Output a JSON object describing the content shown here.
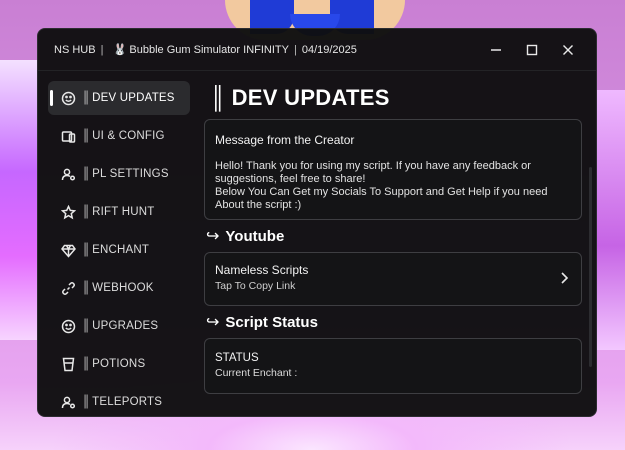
{
  "window": {
    "hub_name": "NS HUB",
    "game_title": "Bubble Gum Simulator INFINITY",
    "date": "04/19/2025",
    "rabbit_glyph": "🐰"
  },
  "sidebar": {
    "items": [
      {
        "label": "DEV UPDATES",
        "icon": "smile-icon"
      },
      {
        "label": "UI & CONFIG",
        "icon": "devices-icon"
      },
      {
        "label": "PL SETTINGS",
        "icon": "user-settings-icon"
      },
      {
        "label": "RIFT HUNT",
        "icon": "star-icon"
      },
      {
        "label": "ENCHANT",
        "icon": "gem-icon"
      },
      {
        "label": "WEBHOOK",
        "icon": "link-icon"
      },
      {
        "label": "UPGRADES",
        "icon": "smile-icon"
      },
      {
        "label": "POTIONS",
        "icon": "cup-icon"
      },
      {
        "label": "TELEPORTS",
        "icon": "user-settings-icon"
      }
    ],
    "pipes": "║"
  },
  "content": {
    "title": "DEV UPDATES",
    "message_card": {
      "heading": "Message from the Creator",
      "line1": "Hello! Thank you for using my script. If you have any feedback or suggestions, feel free to share!",
      "line2": "Below You Can Get my Socials To Support and Get Help if you need About the script :)"
    },
    "youtube_section": "Youtube",
    "youtube_card": {
      "title": "Nameless Scripts",
      "subtitle": "Tap To Copy Link"
    },
    "status_section": "Script Status",
    "status_card": {
      "title": "STATUS",
      "subtitle": "Current Enchant :"
    }
  },
  "colors": {
    "window_bg": "#0e0e10",
    "card_border": "#3e3e42",
    "active_item": "#2b2b2e",
    "accent": "#ffffff"
  }
}
